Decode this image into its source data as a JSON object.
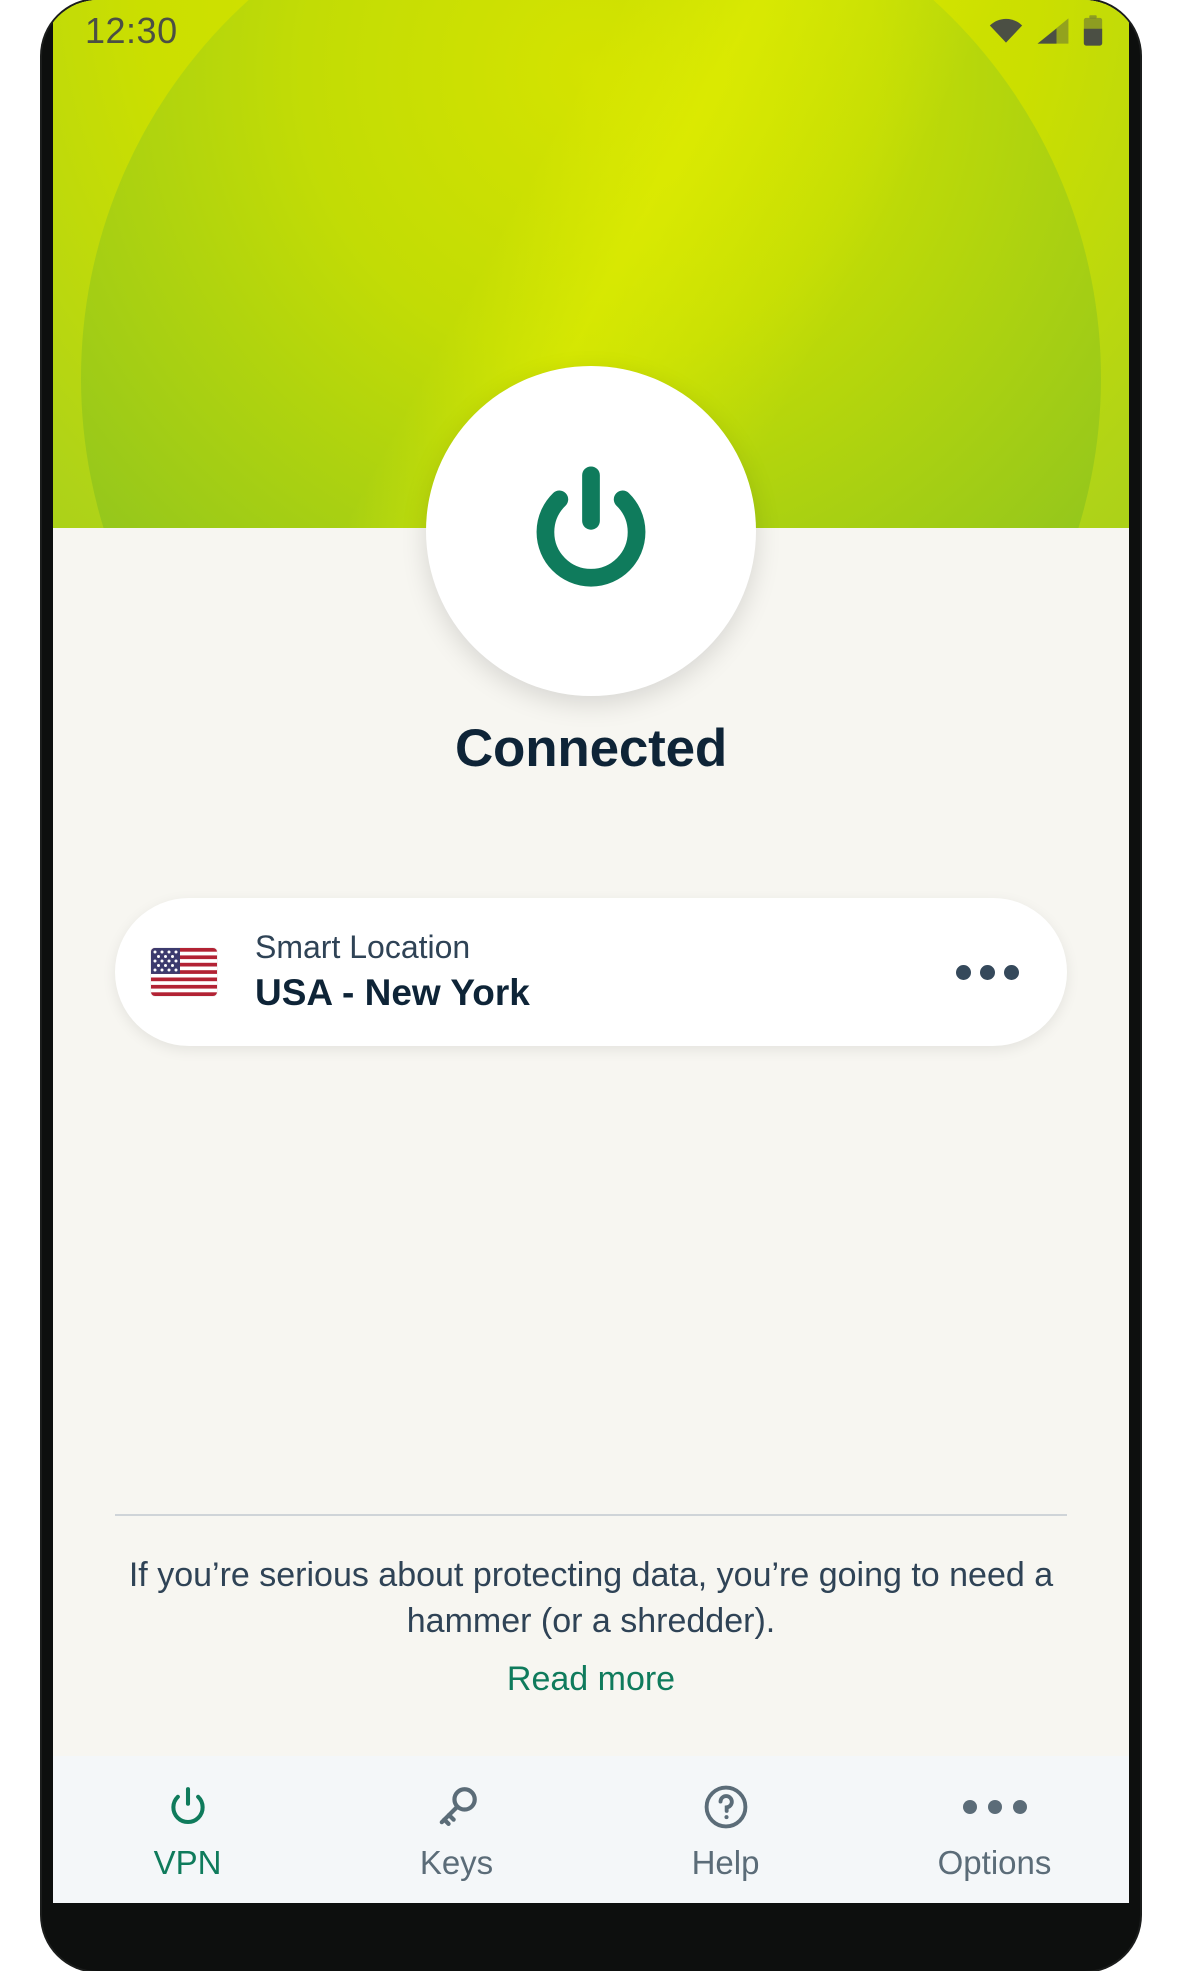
{
  "status_bar": {
    "clock": "12:30",
    "icons": [
      "wifi-icon",
      "cellular-signal-icon",
      "battery-icon"
    ]
  },
  "hero": {
    "power_button_icon": "power-icon",
    "connection_status": "Connected"
  },
  "location_card": {
    "flag_icon": "usa-flag-icon",
    "label": "Smart Location",
    "name": "USA - New York",
    "menu_icon": "more-horizontal-icon"
  },
  "promo": {
    "text": "If you’re serious about protecting data, you’re going to need a hammer (or a shredder).",
    "link": "Read more"
  },
  "bottom_nav": {
    "items": [
      {
        "label": "VPN",
        "icon": "power-icon",
        "active": true
      },
      {
        "label": "Keys",
        "icon": "key-icon",
        "active": false
      },
      {
        "label": "Help",
        "icon": "question-circle-icon",
        "active": false
      },
      {
        "label": "Options",
        "icon": "more-horizontal-icon",
        "active": false
      }
    ]
  },
  "colors": {
    "accent_green": "#0F7B5C",
    "hero_yellow_green": "#C8DC00",
    "hero_green": "#62B62D",
    "text_navy": "#0E2437",
    "text_muted": "#2F4356",
    "screen_bg": "#F7F6F1",
    "nav_bg": "#F4F7F9"
  }
}
